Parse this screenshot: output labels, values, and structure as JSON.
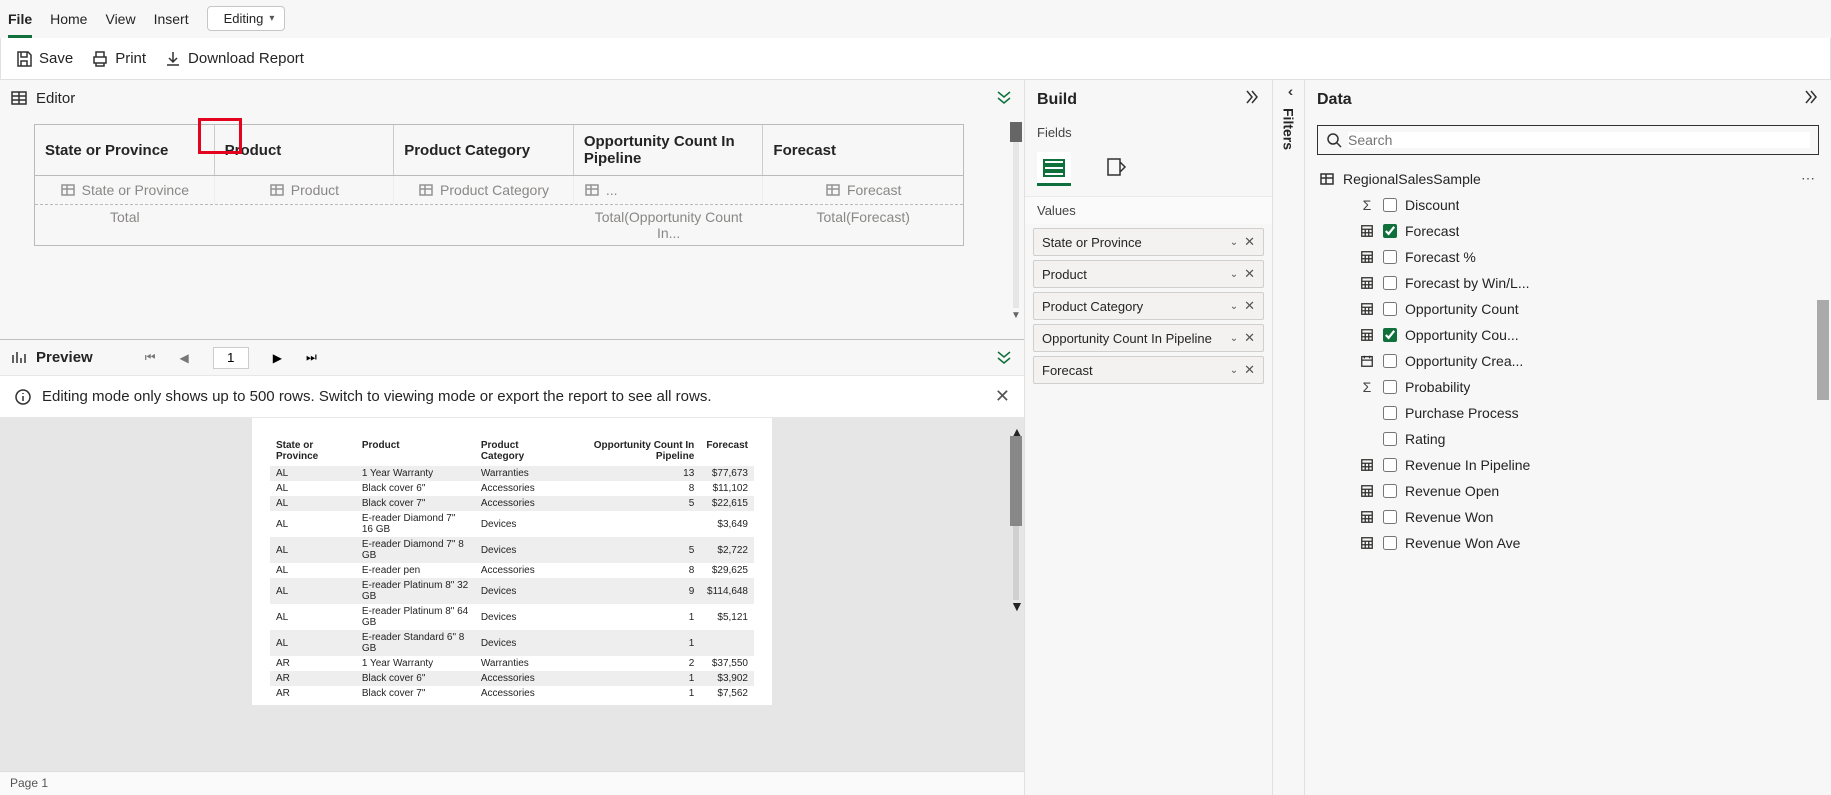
{
  "ribbon": {
    "tabs": [
      "File",
      "Home",
      "View",
      "Insert"
    ],
    "active": "File",
    "editing_label": "Editing"
  },
  "commands": {
    "save": "Save",
    "print": "Print",
    "download": "Download Report"
  },
  "editor": {
    "title": "Editor",
    "headers": [
      "State or Province",
      "Product",
      "Product Category",
      "Opportunity Count In Pipeline",
      "Forecast"
    ],
    "placeholders": [
      "State or Province",
      "Product",
      "Product Category",
      "...",
      "Forecast"
    ],
    "total_label": "Total",
    "totals": [
      "",
      "",
      "",
      "Total(Opportunity Count In...",
      "Total(Forecast)"
    ]
  },
  "preview": {
    "title": "Preview",
    "page": "1",
    "info": "Editing mode only shows up to 500 rows. Switch to viewing mode or export the report to see all rows.",
    "columns": [
      "State or Province",
      "Product",
      "Product Category",
      "Opportunity Count In Pipeline",
      "Forecast"
    ],
    "rows": [
      [
        "AL",
        "1 Year Warranty",
        "Warranties",
        "13",
        "$77,673"
      ],
      [
        "AL",
        "Black cover 6\"",
        "Accessories",
        "8",
        "$11,102"
      ],
      [
        "AL",
        "Black cover 7\"",
        "Accessories",
        "5",
        "$22,615"
      ],
      [
        "AL",
        "E-reader Diamond 7\" 16 GB",
        "Devices",
        "",
        "$3,649"
      ],
      [
        "AL",
        "E-reader Diamond 7\" 8 GB",
        "Devices",
        "5",
        "$2,722"
      ],
      [
        "AL",
        "E-reader pen",
        "Accessories",
        "8",
        "$29,625"
      ],
      [
        "AL",
        "E-reader Platinum 8\" 32 GB",
        "Devices",
        "9",
        "$114,648"
      ],
      [
        "AL",
        "E-reader Platinum 8\" 64 GB",
        "Devices",
        "1",
        "$5,121"
      ],
      [
        "AL",
        "E-reader Standard 6\" 8 GB",
        "Devices",
        "1",
        ""
      ],
      [
        "AR",
        "1 Year Warranty",
        "Warranties",
        "2",
        "$37,550"
      ],
      [
        "AR",
        "Black cover 6\"",
        "Accessories",
        "1",
        "$3,902"
      ],
      [
        "AR",
        "Black cover 7\"",
        "Accessories",
        "1",
        "$7,562"
      ]
    ]
  },
  "status": {
    "page": "Page 1"
  },
  "build": {
    "title": "Build",
    "fields": "Fields",
    "values": "Values",
    "pills": [
      "State or Province",
      "Product",
      "Product Category",
      "Opportunity Count In Pipeline",
      "Forecast"
    ]
  },
  "filters": {
    "label": "Filters"
  },
  "data": {
    "title": "Data",
    "search_placeholder": "Search",
    "dataset": "RegionalSalesSample",
    "fields": [
      {
        "icon": "sigma",
        "label": "Discount",
        "checked": false
      },
      {
        "icon": "calc",
        "label": "Forecast",
        "checked": true
      },
      {
        "icon": "calc",
        "label": "Forecast %",
        "checked": false
      },
      {
        "icon": "calc",
        "label": "Forecast by Win/L...",
        "checked": false
      },
      {
        "icon": "calc",
        "label": "Opportunity Count",
        "checked": false
      },
      {
        "icon": "calc",
        "label": "Opportunity Cou...",
        "checked": true
      },
      {
        "icon": "calendar",
        "label": "Opportunity Crea...",
        "checked": false
      },
      {
        "icon": "sigma",
        "label": "Probability",
        "checked": false
      },
      {
        "icon": "none",
        "label": "Purchase Process",
        "checked": false
      },
      {
        "icon": "none",
        "label": "Rating",
        "checked": false
      },
      {
        "icon": "calc",
        "label": "Revenue In Pipeline",
        "checked": false
      },
      {
        "icon": "calc",
        "label": "Revenue Open",
        "checked": false
      },
      {
        "icon": "calc",
        "label": "Revenue Won",
        "checked": false
      },
      {
        "icon": "calc",
        "label": "Revenue Won Ave",
        "checked": false
      }
    ]
  }
}
